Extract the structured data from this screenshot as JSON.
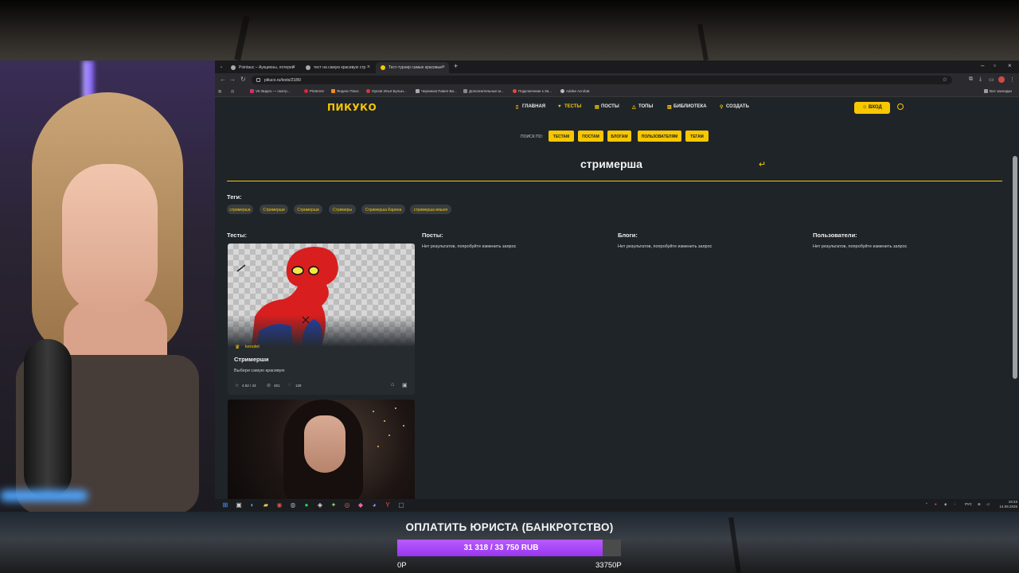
{
  "browser": {
    "tabs": [
      {
        "title": "Pointauc – Аукционы, лотереи"
      },
      {
        "title": "тест на самую красивую стр"
      },
      {
        "title": "Тест-турнир самые красивые"
      }
    ],
    "url": "pikuco.ru/tests/2186/",
    "bookmarks": [
      "VK Видео — смотр...",
      "Pinterest",
      "Яндекс Плюс",
      "Орлов Илья Булын...",
      "Черников Павел Ва...",
      "Дополнительные м...",
      "Подключение к За...",
      "Adobe Acrobat",
      "Все закладки"
    ]
  },
  "site": {
    "logo": "ПИКУКО",
    "nav": [
      {
        "label": "ГЛАВНАЯ",
        "icon": "home-icon"
      },
      {
        "label": "ТЕСТЫ",
        "icon": "heart-icon"
      },
      {
        "label": "ПОСТЫ",
        "icon": "document-icon"
      },
      {
        "label": "ТОПЫ",
        "icon": "bell-icon"
      },
      {
        "label": "БИБЛИОТЕКА",
        "icon": "book-icon"
      },
      {
        "label": "СОЗДАТЬ",
        "icon": "bulb-icon"
      }
    ],
    "login_label": "ВХОД",
    "search_by_label": "ПОИСК ПО:",
    "search_chips": [
      "ТЕСТАМ",
      "ПОСТАМ",
      "БЛОГАМ",
      "ПОЛЬЗОВАТЕЛЯМ",
      "ТЕГАМ"
    ],
    "query": "стримерша",
    "tags_heading": "Теги:",
    "tags": [
      "стримерша",
      "Стримерши",
      "Стримерши",
      "Стримеры",
      "Стримерша Карина",
      "стримерша вишня"
    ],
    "sections": {
      "tests": "Тесты:",
      "posts": "Посты:",
      "blogs": "Блоги:",
      "users": "Пользователи:"
    },
    "no_results": "Нет результатов, попробуйте изменить запрос",
    "card": {
      "author": "kenolet",
      "title": "Стримерши",
      "description": "Выбери самую красивую",
      "rating": "4.52 / 43",
      "plays": "451",
      "comments": "128"
    }
  },
  "taskbar": {
    "lang": "РУС",
    "time": "19:43",
    "date": "14.09.2026"
  },
  "donation": {
    "title": "ОПЛАТИТЬ ЮРИСТА (БАНКРОТСТВО)",
    "progress_text": "31 318 / 33 750 RUB",
    "current": 31318,
    "goal": 33750,
    "min_label": "0Р",
    "max_label": "33750Р",
    "fill_color": "#a546f5"
  },
  "colors": {
    "accent": "#f7c700",
    "site_bg": "#1f2428"
  }
}
